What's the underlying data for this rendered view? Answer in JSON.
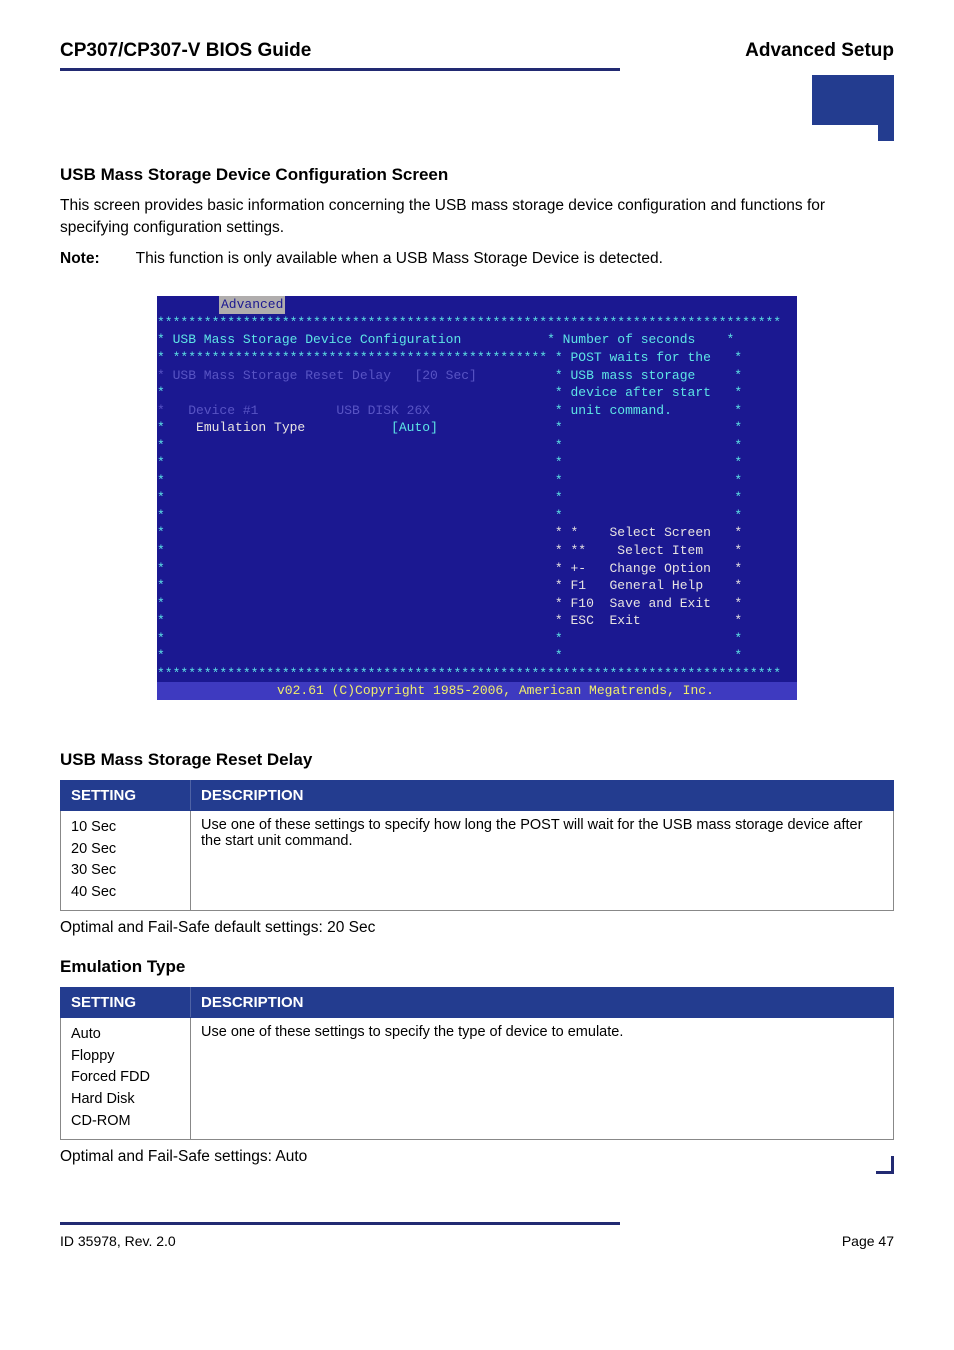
{
  "header": {
    "left": "CP307/CP307-V BIOS Guide",
    "right": "Advanced Setup"
  },
  "section1": {
    "title": "USB Mass Storage Device Configuration Screen",
    "para": "This screen provides basic information concerning the USB mass storage device configuration and functions for specifying configuration settings.",
    "note_label": "Note:",
    "note_text": "This function is only available when a USB Mass Storage Device is detected."
  },
  "bios": {
    "tab": "Advanced",
    "stars_top1": "********************************************************************************",
    "line_title_l": "* USB Mass Storage Device Configuration",
    "line_title_r": "* Number of seconds    *",
    "stars_sub": "* ************************************************ * POST waits for the   *",
    "line_delay_l": "* USB Mass Storage Reset Delay   [20 Sec]",
    "line_delay_r": "* USB mass storage     *",
    "line_blank1_l": "*",
    "line_blank1_r": "* device after start   *",
    "line_dev_l": "*   Device #1          USB DISK 26X",
    "line_dev_r": "* unit command.        *",
    "line_emu_l": "*    Emulation Type           [Auto]",
    "line_emu_r": "*                      *",
    "blank_l": "*",
    "blank_r": "*                      *",
    "nav1_r": "* *    Select Screen   *",
    "nav2_r": "* **    Select Item    *",
    "nav3_r": "* +-   Change Option   *",
    "nav4_r": "* F1   General Help    *",
    "nav5_r": "* F10  Save and Exit   *",
    "nav6_r": "* ESC  Exit            *",
    "stars_bottom": "********************************************************************************",
    "footer": "v02.61 (C)Copyright 1985-2006, American Megatrends, Inc."
  },
  "table1": {
    "title": "USB Mass Storage Reset Delay",
    "head_setting": "SETTING",
    "head_desc": "DESCRIPTION",
    "settings": "10 Sec\n20 Sec\n30 Sec\n40 Sec",
    "desc": "Use one of these settings to specify how long the POST will wait for the USB mass storage device after the start unit command.",
    "after": "Optimal and Fail-Safe default settings: 20 Sec"
  },
  "table2": {
    "title": "Emulation Type",
    "head_setting": "SETTING",
    "head_desc": "DESCRIPTION",
    "settings": "Auto\nFloppy\nForced FDD\nHard Disk\nCD-ROM",
    "desc": "Use one of these settings to specify the type of device to emulate.",
    "after": "Optimal and Fail-Safe settings: Auto"
  },
  "footer": {
    "left": "ID 35978, Rev. 2.0",
    "right": "Page 47"
  }
}
